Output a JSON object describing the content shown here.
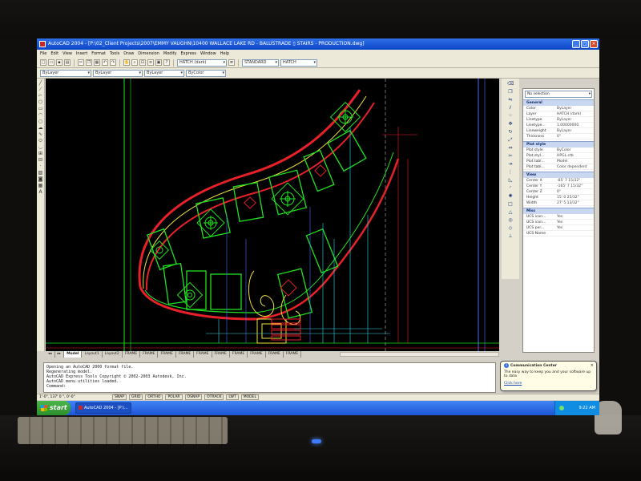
{
  "window": {
    "title": "AutoCAD 2004 - [P:\\02_Client Projects\\2007\\EMMY VAUGHN\\10400 WALLACE LAKE RD - BALUSTRADE ▯ STAIRS - PRODUCTION.dwg]",
    "buttons": {
      "min": "_",
      "max": "□",
      "close": "×"
    }
  },
  "menu": [
    "File",
    "Edit",
    "View",
    "Insert",
    "Format",
    "Tools",
    "Draw",
    "Dimension",
    "Modify",
    "Express",
    "Window",
    "Help"
  ],
  "toolbar": {
    "layer_combo": "HATCH (dark)",
    "linetype_combo": "STANDARD",
    "style_combo": "HATCH",
    "color_combo": "ByLayer",
    "linetype2_combo": "ByLayer",
    "lineweight_combo": "ByLayer",
    "plotstyle_combo": "ByColor"
  },
  "layout_tabs": [
    "Model",
    "Layout1",
    "Layout2",
    "FRAME",
    "FRAME",
    "FRAME",
    "FRAME",
    "FRAME",
    "FRAME",
    "FRAME",
    "FRAME",
    "FRAME",
    "FRAME"
  ],
  "properties": {
    "selection": "No selection",
    "sections": [
      {
        "title": "General",
        "rows": [
          {
            "k": "Color",
            "v": "ByLayer"
          },
          {
            "k": "Layer",
            "v": "HATCH (dark)"
          },
          {
            "k": "Linetype",
            "v": "ByLayer"
          },
          {
            "k": "Linetype...",
            "v": "1.00000000"
          },
          {
            "k": "Lineweight",
            "v": "ByLayer"
          },
          {
            "k": "Thickness",
            "v": "0\""
          }
        ]
      },
      {
        "title": "Plot style",
        "rows": [
          {
            "k": "Plot style",
            "v": "ByColor"
          },
          {
            "k": "Plot styl...",
            "v": "HPGL.ctb"
          },
          {
            "k": "Plot tabl...",
            "v": "Model"
          },
          {
            "k": "Plot tabl...",
            "v": "Color dependent"
          }
        ]
      },
      {
        "title": "View",
        "rows": [
          {
            "k": "Center X",
            "v": "-85' 7 15/32\""
          },
          {
            "k": "Center Y",
            "v": "-165' 7 15/32\""
          },
          {
            "k": "Center Z",
            "v": "0\""
          },
          {
            "k": "Height",
            "v": "15' 0 25/32\""
          },
          {
            "k": "Width",
            "v": "27' 5 13/32\""
          }
        ]
      },
      {
        "title": "Misc",
        "rows": [
          {
            "k": "UCS icon...",
            "v": "Yes"
          },
          {
            "k": "UCS icon...",
            "v": "Yes"
          },
          {
            "k": "UCS per...",
            "v": "Yes"
          },
          {
            "k": "UCS Name",
            "v": ""
          }
        ]
      }
    ]
  },
  "command": {
    "lines": [
      "Opening an AutoCAD 2000 format file.",
      "Regenerating model.",
      "AutoCAD Express Tools Copyright © 2002-2003 Autodesk, Inc.",
      "AutoCAD menu utilities loaded.",
      "",
      "Command:"
    ]
  },
  "status": {
    "coords": "1'-0\", 137' 0 \", 0'-0\"",
    "toggles": [
      "SNAP",
      "GRID",
      "ORTHO",
      "POLAR",
      "OSNAP",
      "OTRACK",
      "LWT",
      "MODEL"
    ]
  },
  "notification": {
    "title": "Communication Center",
    "body": "The easy way to keep you and your software up to date",
    "link": "Click here",
    "close": "×"
  },
  "taskbar": {
    "start": "start",
    "task": "AutoCAD 2004 - [P:\\...",
    "clock": "9:22 AM"
  },
  "colors": {
    "drawing_bg": "#000000",
    "line_red": "#e8202a",
    "line_green": "#1fe21f",
    "line_yellow": "#f0e23a",
    "line_cyan": "#2fd8e8",
    "line_blue": "#4a6bff",
    "xp_blue": "#2f6fe8"
  }
}
